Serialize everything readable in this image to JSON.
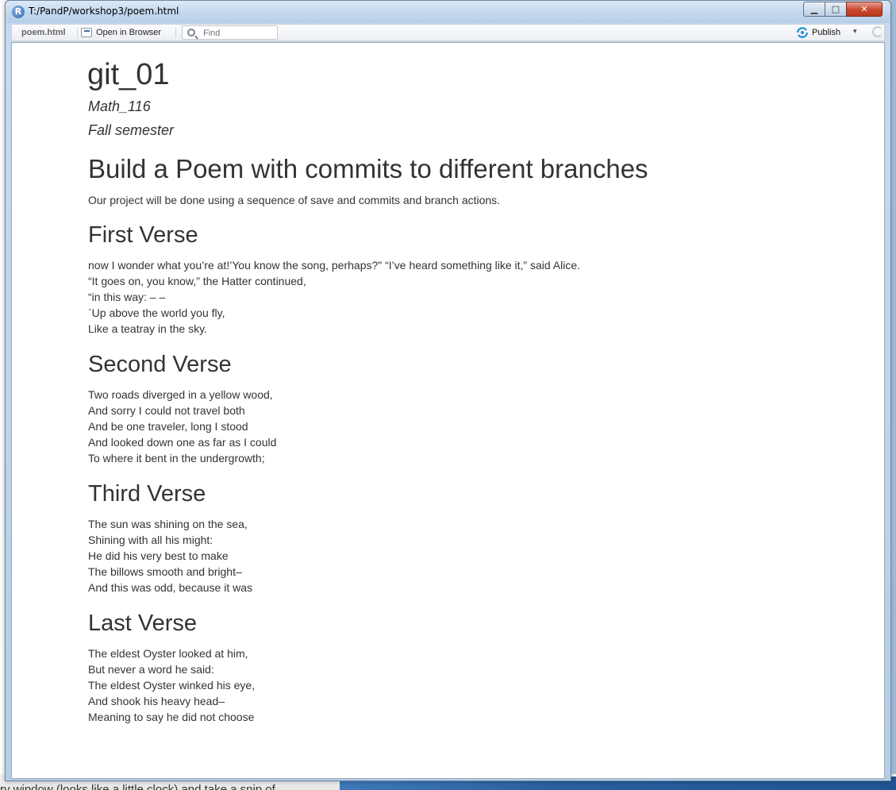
{
  "window": {
    "title": "T:/PandP/workshop3/poem.html",
    "app_icon_glyph": "R",
    "minimize_glyph": "▁",
    "maximize_glyph": "□",
    "close_glyph": "✕"
  },
  "toolbar": {
    "tab_label": "poem.html",
    "open_browser_label": "Open in Browser",
    "find_placeholder": "Find",
    "publish_label": "Publish",
    "publish_caret": "▾"
  },
  "background": {
    "behind_text": "ry window (looks like a little clock) and take a snip of"
  },
  "document": {
    "title": "git_01",
    "author": "Math_116",
    "date": "Fall semester",
    "heading": "Build a Poem with commits to different branches",
    "intro": "Our project will be done using a sequence of save and commits and branch actions.",
    "verses": [
      {
        "heading": "First Verse",
        "lines": [
          "now I wonder what you’re at!’You know the song, perhaps?\" “I’ve heard something like it,” said Alice.",
          "“It goes on, you know,” the Hatter continued,",
          "“in this way: – –",
          "`Up above the world you fly,",
          "Like a teatray in the sky."
        ]
      },
      {
        "heading": "Second Verse",
        "lines": [
          "Two roads diverged in a yellow wood,",
          "And sorry I could not travel both",
          "And be one traveler, long I stood",
          "And looked down one as far as I could",
          "To where it bent in the undergrowth;"
        ]
      },
      {
        "heading": "Third Verse",
        "lines": [
          "The sun was shining on the sea,",
          "Shining with all his might:",
          "He did his very best to make",
          "The billows smooth and bright–",
          "And this was odd, because it was"
        ]
      },
      {
        "heading": "Last Verse",
        "lines": [
          "The eldest Oyster looked at him,",
          "But never a word he said:",
          "The eldest Oyster winked his eye,",
          "And shook his heavy head–",
          "Meaning to say he did not choose"
        ]
      }
    ]
  },
  "colors": {
    "text": "#333333",
    "publish_icon": "#1a8fd6",
    "close_button": "#c9462c"
  }
}
